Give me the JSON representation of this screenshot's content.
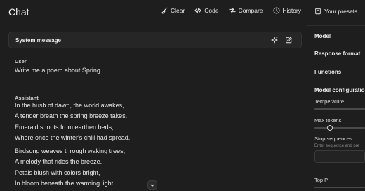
{
  "app": {
    "title": "Chat"
  },
  "toolbar": {
    "clear_label": "Clear",
    "code_label": "Code",
    "compare_label": "Compare",
    "history_label": "History"
  },
  "system": {
    "label": "System message"
  },
  "conversation": {
    "user_role": "User",
    "user_message": "Write me a poem about Spring",
    "assistant_role": "Assistant",
    "stanza1": [
      "In the hush of dawn, the world awakes,",
      "A tender breath the spring breeze takes.",
      "Emerald shoots from earthen beds,",
      "Where once the winter's chill had spread."
    ],
    "stanza2": [
      "Birdsong weaves through waking trees,",
      "A melody that rides the breeze.",
      "Petals blush with colors bright,",
      "In bloom beneath the warming light."
    ]
  },
  "panel": {
    "presets_label": "Your presets",
    "model_label": "Model",
    "response_format_label": "Response format",
    "functions_label": "Functions",
    "model_config_label": "Model configuration",
    "temperature_label": "Temperature",
    "max_tokens_label": "Max tokens",
    "stop_sequences_label": "Stop sequences",
    "stop_sequences_placeholder": "Enter sequence and pre",
    "top_p_label": "Top P"
  },
  "icons": {
    "clear": "broom-icon",
    "code": "code-brackets-icon",
    "compare": "compare-icon",
    "history": "history-clock-icon",
    "presets": "bookmark-icon",
    "sparkle": "sparkle-icon",
    "edit": "edit-icon",
    "scroll": "chevron-down-icon"
  }
}
